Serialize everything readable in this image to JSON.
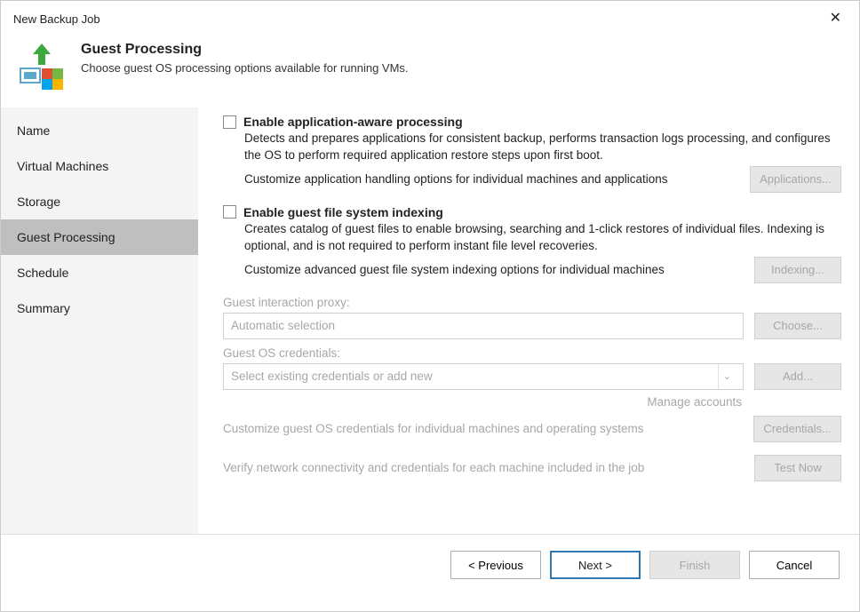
{
  "window": {
    "title": "New Backup Job"
  },
  "header": {
    "title": "Guest Processing",
    "subtitle": "Choose guest OS processing options available for running VMs."
  },
  "sidebar": {
    "items": [
      {
        "label": "Name",
        "active": false
      },
      {
        "label": "Virtual Machines",
        "active": false
      },
      {
        "label": "Storage",
        "active": false
      },
      {
        "label": "Guest Processing",
        "active": true
      },
      {
        "label": "Schedule",
        "active": false
      },
      {
        "label": "Summary",
        "active": false
      }
    ]
  },
  "options": {
    "app_aware": {
      "title": "Enable application-aware processing",
      "desc": "Detects and prepares applications for consistent backup, performs transaction logs processing, and configures the OS to perform required application restore steps upon first boot.",
      "customize": "Customize application handling options for individual machines and applications",
      "button": "Applications..."
    },
    "indexing": {
      "title": "Enable guest file system indexing",
      "desc": "Creates catalog of guest files to enable browsing, searching and 1-click restores of individual files. Indexing is optional, and is not required to perform instant file level recoveries.",
      "customize": "Customize advanced guest file system indexing options for individual machines",
      "button": "Indexing..."
    }
  },
  "proxy": {
    "label": "Guest interaction proxy:",
    "value": "Automatic selection",
    "button": "Choose..."
  },
  "creds": {
    "label": "Guest OS credentials:",
    "value": "Select existing credentials or add new",
    "button": "Add...",
    "manage": "Manage accounts",
    "customize": "Customize guest OS credentials for individual machines and operating systems",
    "cred_button": "Credentials..."
  },
  "verify": {
    "text": "Verify network connectivity and credentials for each machine included in the job",
    "button": "Test Now"
  },
  "footer": {
    "previous": "< Previous",
    "next": "Next >",
    "finish": "Finish",
    "cancel": "Cancel"
  }
}
